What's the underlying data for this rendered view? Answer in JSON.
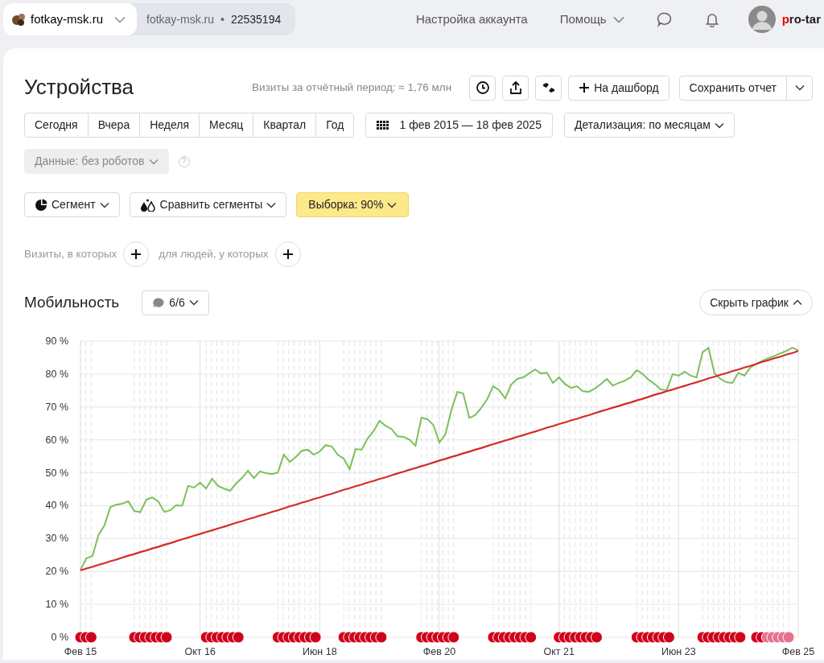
{
  "topbar": {
    "site_tab": {
      "label": "fotkay-msk.ru"
    },
    "counter": {
      "site": "fotkay-msk.ru",
      "separator": "•",
      "id": "22535194"
    },
    "links": [
      "Настройка аккаунта",
      "Помощь"
    ],
    "brand": {
      "accent": "p",
      "rest": "ro-tar"
    }
  },
  "report": {
    "title": "Устройства",
    "visits_info": "Визиты за отчётный период: ≈ 1,76 млн",
    "dashboard_button": "На дашборд",
    "save_button": "Сохранить отчет"
  },
  "periods": [
    {
      "label": "Сегодня",
      "selected": false
    },
    {
      "label": "Вчера",
      "selected": false
    },
    {
      "label": "Неделя",
      "selected": false
    },
    {
      "label": "Месяц",
      "selected": false
    },
    {
      "label": "Квартал",
      "selected": false
    },
    {
      "label": "Год",
      "selected": false
    }
  ],
  "date_range": "1 фев 2015 — 18 фев 2025",
  "detail": "Детализация: по месяцам",
  "data_filter": {
    "label": "Данные: без роботов",
    "disabled": true,
    "help": "?"
  },
  "segments": [
    {
      "kind": "segment",
      "label": "Сегмент"
    },
    {
      "kind": "compare",
      "label": "Сравнить сегменты"
    },
    {
      "kind": "sample",
      "label": "Выборка: 90%"
    }
  ],
  "conditions": [
    "Визиты, в которых",
    "для людей, у которых"
  ],
  "chart_header": {
    "notes": "6/6",
    "toggle": "Скрыть график"
  },
  "chart_data": {
    "type": "line",
    "grid": true,
    "categories": [
      "Фев 15",
      null,
      null,
      null,
      null,
      null,
      null,
      null,
      null,
      null,
      null,
      null,
      null,
      null,
      null,
      null,
      null,
      null,
      null,
      null,
      "Окт 16",
      null,
      null,
      null,
      null,
      null,
      null,
      null,
      null,
      null,
      null,
      null,
      null,
      null,
      null,
      null,
      null,
      null,
      null,
      null,
      "Июн 18",
      null,
      null,
      null,
      null,
      null,
      null,
      null,
      null,
      null,
      null,
      null,
      null,
      null,
      null,
      null,
      null,
      null,
      null,
      null,
      "Фев 20",
      null,
      null,
      null,
      null,
      null,
      null,
      null,
      null,
      null,
      null,
      null,
      null,
      null,
      null,
      null,
      null,
      null,
      null,
      null,
      "Окт 21",
      null,
      null,
      null,
      null,
      null,
      null,
      null,
      null,
      null,
      null,
      null,
      null,
      null,
      null,
      null,
      null,
      null,
      null,
      null,
      "Июн 23",
      null,
      null,
      null,
      null,
      null,
      null,
      null,
      null,
      null,
      null,
      null,
      null,
      null,
      null,
      null,
      null,
      null,
      null,
      null,
      "Фев 25"
    ],
    "ylim": [
      0,
      90
    ],
    "yticks": [
      {
        "value": 0,
        "label": "0 %"
      },
      {
        "value": 10,
        "label": "10 %"
      },
      {
        "value": 20,
        "label": "20 %"
      },
      {
        "value": 30,
        "label": "30 %"
      },
      {
        "value": 40,
        "label": "40 %"
      },
      {
        "value": 50,
        "label": "50 %"
      },
      {
        "value": 60,
        "label": "60 %"
      },
      {
        "value": 70,
        "label": "70 %"
      },
      {
        "value": 80,
        "label": "80 %"
      },
      {
        "value": 90,
        "label": "90 %"
      }
    ],
    "series": [
      {
        "name": "Мобильность",
        "color": "#7cc05a",
        "values": [
          20.5,
          24,
          24.7,
          31,
          34,
          39.6,
          40.3,
          40.6,
          41.3,
          38.4,
          38,
          41.8,
          42.5,
          41.3,
          38.1,
          38.6,
          40.1,
          40,
          46,
          45.5,
          47,
          45.2,
          48.2,
          46,
          45.2,
          44.5,
          46.7,
          48.4,
          50.6,
          48.4,
          50.4,
          49.9,
          49.6,
          50.1,
          55.5,
          53.3,
          54.8,
          56.7,
          57,
          55.5,
          56.5,
          58.4,
          58,
          55.5,
          54.3,
          51.1,
          57.2,
          57,
          60.4,
          62.6,
          65.8,
          64.3,
          63.3,
          61.1,
          60.9,
          60.1,
          58.2,
          66.7,
          66.3,
          64.5,
          59.2,
          61.6,
          69,
          74.6,
          74.1,
          66.7,
          67.5,
          69.7,
          72.4,
          76.3,
          75.1,
          72.6,
          76.8,
          78.5,
          79,
          80.2,
          81.4,
          80.2,
          80.4,
          77.3,
          79,
          77,
          75.8,
          76.3,
          74.8,
          74.6,
          75.6,
          77,
          78.5,
          76.5,
          77.3,
          78,
          79,
          81.2,
          80,
          78.2,
          77,
          75.3,
          75.1,
          80,
          79.5,
          80.7,
          79.5,
          79,
          86.6,
          88,
          80.2,
          78.5,
          77.5,
          77.3,
          80.4,
          79.5,
          82,
          83.1,
          84,
          84.8,
          85.5,
          86.3,
          87,
          88,
          87.2
        ]
      },
      {
        "color": "#d42a2a",
        "values": [
          20.3,
          20.9,
          21.4,
          22.0,
          22.5,
          23.1,
          23.6,
          24.2,
          24.8,
          25.3,
          25.9,
          26.4,
          27.0,
          27.5,
          28.1,
          28.6,
          29.2,
          29.8,
          30.3,
          30.9,
          31.4,
          32.0,
          32.5,
          33.1,
          33.6,
          34.2,
          34.8,
          35.3,
          35.9,
          36.4,
          37.0,
          37.5,
          38.1,
          38.6,
          39.2,
          39.8,
          40.3,
          40.9,
          41.4,
          42.0,
          42.5,
          43.1,
          43.6,
          44.2,
          44.8,
          45.3,
          45.9,
          46.4,
          47.0,
          47.5,
          48.1,
          48.6,
          49.2,
          49.8,
          50.3,
          50.9,
          51.4,
          52.0,
          52.5,
          53.1,
          53.7,
          54.2,
          54.8,
          55.3,
          55.9,
          56.4,
          57.0,
          57.5,
          58.1,
          58.7,
          59.2,
          59.8,
          60.3,
          60.9,
          61.4,
          62.0,
          62.5,
          63.1,
          63.7,
          64.2,
          64.8,
          65.3,
          65.9,
          66.4,
          67.0,
          67.5,
          68.1,
          68.7,
          69.2,
          69.8,
          70.3,
          70.9,
          71.4,
          72.0,
          72.5,
          73.1,
          73.7,
          74.2,
          74.8,
          75.3,
          75.9,
          76.4,
          77.0,
          77.5,
          78.1,
          78.7,
          79.2,
          79.8,
          80.3,
          80.9,
          81.4,
          82.0,
          82.5,
          83.1,
          83.7,
          84.2,
          84.8,
          85.3,
          85.9,
          86.4,
          87.0
        ]
      }
    ]
  }
}
